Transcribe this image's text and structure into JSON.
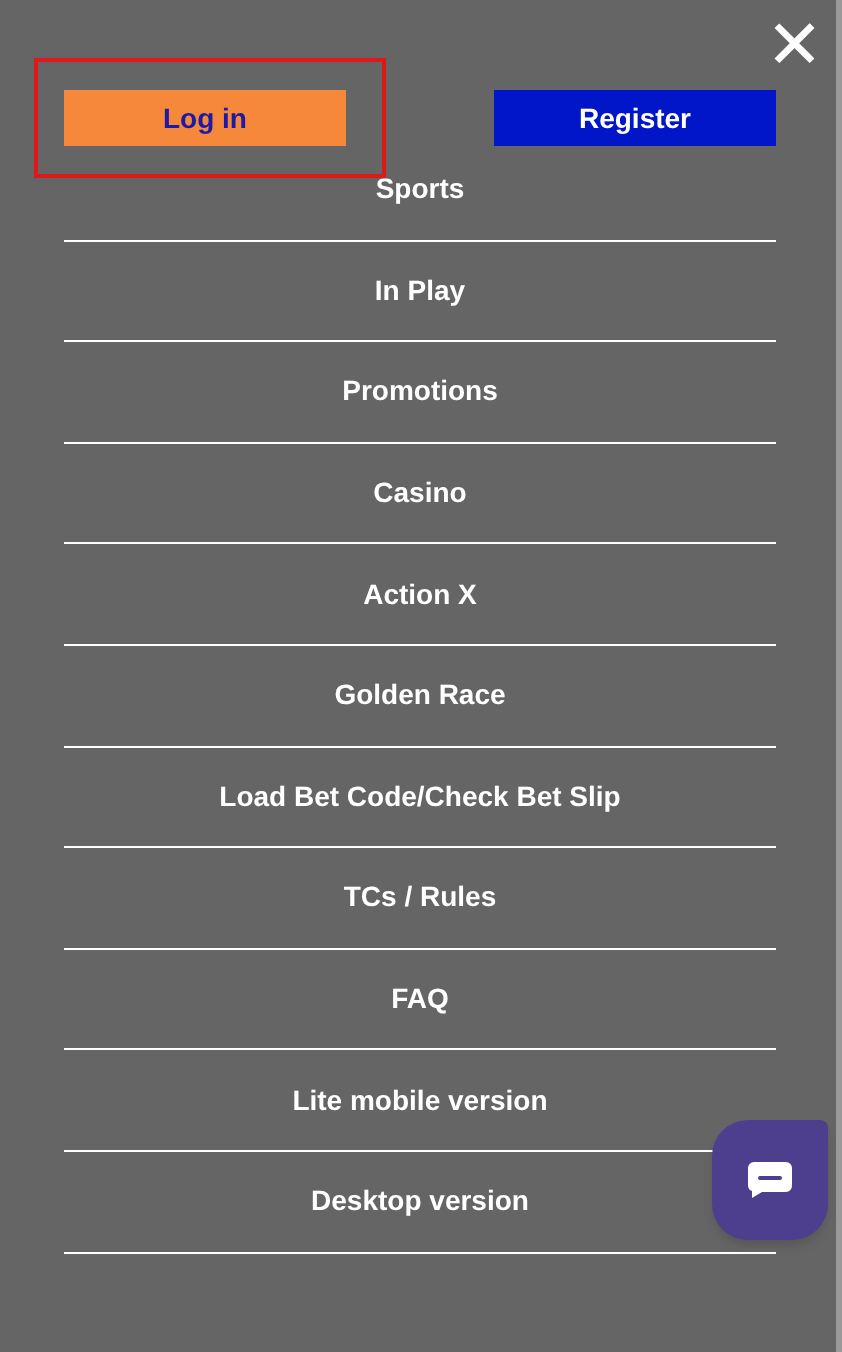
{
  "close_button": {
    "label": "✕"
  },
  "auth_buttons": [
    {
      "label": "Log in",
      "kind": "login",
      "highlighted": true
    },
    {
      "label": "Register",
      "kind": "register",
      "highlighted": false
    }
  ],
  "menu": [
    {
      "label": "Sports"
    },
    {
      "label": "In Play"
    },
    {
      "label": "Promotions"
    },
    {
      "label": "Casino"
    },
    {
      "label": "Action X"
    },
    {
      "label": "Golden Race"
    },
    {
      "label": "Load Bet Code/Check Bet Slip"
    },
    {
      "label": "TCs / Rules"
    },
    {
      "label": "FAQ"
    },
    {
      "label": "Lite mobile version"
    },
    {
      "label": "Desktop version"
    }
  ]
}
